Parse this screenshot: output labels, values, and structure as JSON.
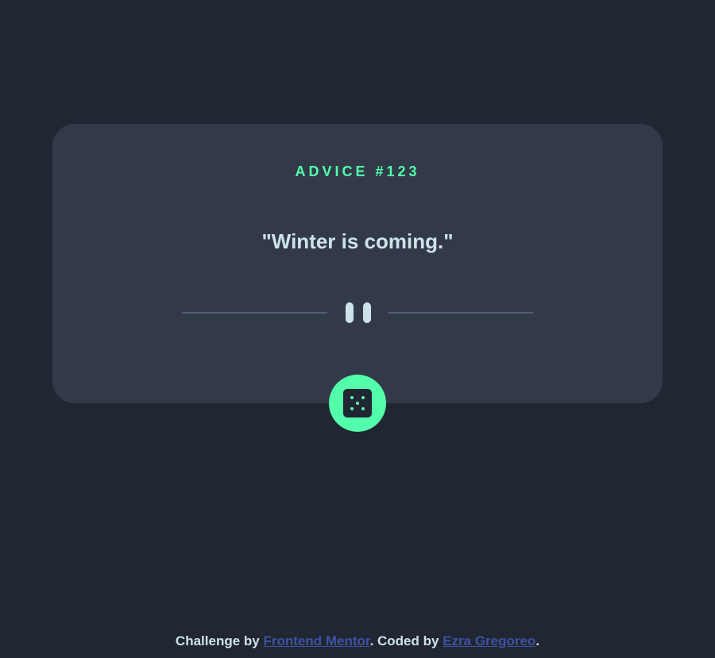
{
  "card": {
    "advice_label": "ADVICE #123",
    "quote": "\"Winter is coming.\""
  },
  "divider": {
    "icon": "pause-icon"
  },
  "dice_button": {
    "icon": "dice-icon"
  },
  "footer": {
    "challenge_prefix": "Challenge by ",
    "challenge_link": "Frontend Mentor",
    "coded_prefix": ". Coded by ",
    "author_link": "Ezra Gregoreo",
    "suffix": "."
  },
  "colors": {
    "background": "#202632",
    "card": "#323a49",
    "accent_green": "#53ffaa",
    "text_light": "#cee3e9",
    "divider": "#4f5d74",
    "link": "#3e52a3"
  }
}
